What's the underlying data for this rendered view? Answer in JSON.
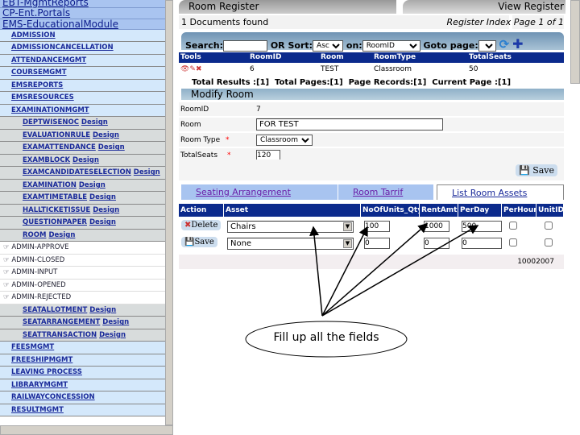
{
  "sidebar": {
    "top": [
      "EBT-MgmtReports",
      "CP-Ent.Portals",
      "EMS-EducationalModule"
    ],
    "level1a": [
      "ADMISSION",
      "ADMISSIONCANCELLATION",
      "ATTENDANCEMGMT",
      "COURSEMGMT",
      "EMSREPORTS",
      "EMSRESOURCES",
      "EXAMINATIONMGMT"
    ],
    "level2a": [
      "DEPTWISENOC",
      "EVALUATIONRULE",
      "EXAMATTENDANCE",
      "EXAMBLOCK",
      "EXAMCANDIDATESELECTION",
      "EXAMINATION",
      "EXAMTIMETABLE",
      "HALLTICKETISSUE",
      "QUESTIONPAPER",
      "ROOM"
    ],
    "design_label": "Design",
    "admin": [
      "ADMIN-APPROVE",
      "ADMIN-CLOSED",
      "ADMIN-INPUT",
      "ADMIN-OPENED",
      "ADMIN-REJECTED"
    ],
    "level2b": [
      "SEATALLOTMENT",
      "SEATARRANGEMENT",
      "SEATTRANSACTION"
    ],
    "level1b": [
      "FEESMGMT",
      "FREESHIPMGMT",
      "LEAVING PROCESS",
      "LIBRARYMGMT",
      "RAILWAYCONCESSION",
      "RESULTMGMT"
    ]
  },
  "header": {
    "title": "Room Register",
    "view": "View Register",
    "found": "1 Documents found",
    "index": "Register Index Page 1 of 1"
  },
  "search": {
    "label": "Search:",
    "sort_label": "OR Sort:",
    "sort": "Asc",
    "on_label": "on:",
    "on": "RoomID",
    "goto_label": "Goto page:"
  },
  "table": {
    "headers": [
      "Tools",
      "RoomID",
      "Room",
      "RoomType",
      "TotalSeats"
    ],
    "row": [
      "6",
      "TEST",
      "Classroom",
      "50"
    ],
    "summary": "Total Results :[1]  Total Pages:[1]  Page Records:[1]  Current Page :[1]"
  },
  "form": {
    "title": "Modify Room",
    "fields": [
      {
        "label": "RoomID",
        "value": "7"
      },
      {
        "label": "Room",
        "value": "FOR TEST"
      },
      {
        "label": "Room Type",
        "value": "Classroom"
      },
      {
        "label": "TotalSeats",
        "value": "120"
      }
    ],
    "save": "Save"
  },
  "tabs": [
    "Seating Arrangement",
    "Room Tarrif",
    "List Room Assets"
  ],
  "assets": {
    "headers": [
      "Action",
      "Asset",
      "NoOfUnits_Qty",
      "RentAmt",
      "PerDay",
      "PerHour",
      "UnitID"
    ],
    "rows": [
      {
        "action": "Delete",
        "asset": "Chairs",
        "qty": "100",
        "rent": "1000",
        "perday": "500"
      },
      {
        "action": "Save",
        "asset": "None",
        "qty": "0",
        "rent": "0",
        "perday": "0"
      }
    ],
    "footer": "10002007"
  },
  "annotation": "Fill up all the fields",
  "colors": {
    "header_blue": "#0b2a8c",
    "sidebar_blue": "#d4e8fb",
    "link": "#1a2a9a"
  }
}
